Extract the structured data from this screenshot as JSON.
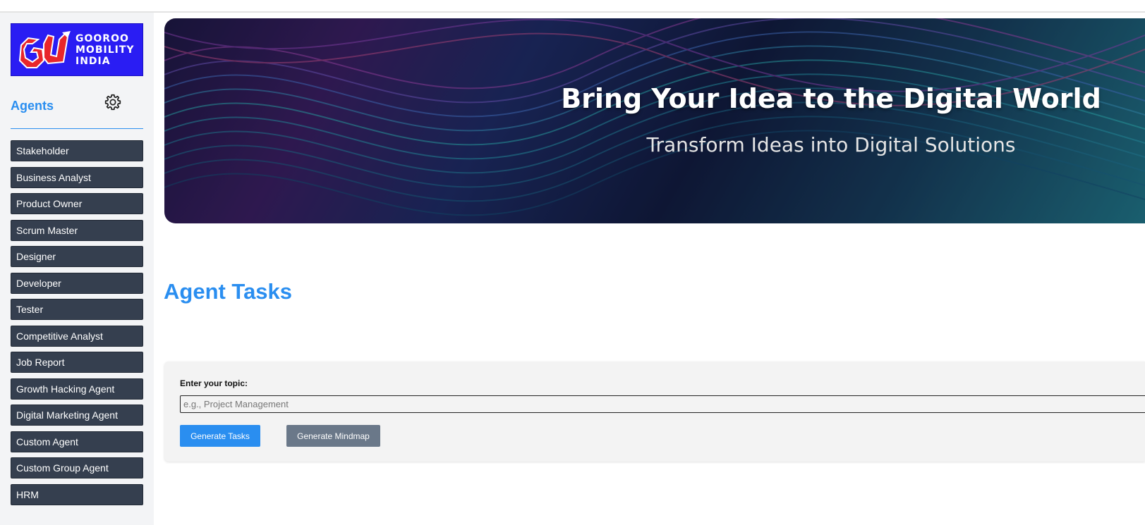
{
  "sidebar": {
    "logo": {
      "line1": "GOOROO",
      "line2": "MOBILITY",
      "line3": "INDIA",
      "background": "#2a1df3"
    },
    "title": "Agents",
    "settings_icon": "gear-icon",
    "items": [
      {
        "label": "Stakeholder"
      },
      {
        "label": "Business Analyst"
      },
      {
        "label": "Product Owner"
      },
      {
        "label": "Scrum Master"
      },
      {
        "label": "Designer"
      },
      {
        "label": "Developer"
      },
      {
        "label": "Tester"
      },
      {
        "label": "Competitive Analyst"
      },
      {
        "label": "Job Report"
      },
      {
        "label": "Growth Hacking Agent"
      },
      {
        "label": "Digital Marketing Agent"
      },
      {
        "label": "Custom Agent"
      },
      {
        "label": "Custom Group Agent"
      },
      {
        "label": "HRM"
      }
    ]
  },
  "banner": {
    "title": "Bring Your Idea to the Digital World",
    "subtitle": "Transform Ideas into Digital Solutions"
  },
  "main": {
    "title": "Agent Tasks",
    "form": {
      "label": "Enter your topic:",
      "placeholder": "e.g., Project Management",
      "value": "",
      "generate_tasks_label": "Generate Tasks",
      "generate_mindmap_label": "Generate Mindmap"
    }
  },
  "colors": {
    "accent": "#2a8ef0",
    "sidebar_button": "#353f4f",
    "secondary_button": "#6a7889"
  }
}
